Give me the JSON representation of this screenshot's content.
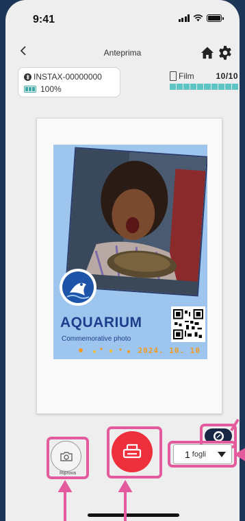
{
  "status": {
    "time": "9:41"
  },
  "nav": {
    "title": "Anteprima"
  },
  "device": {
    "name": "INSTAX-00000000",
    "battery": "100%"
  },
  "film": {
    "label": "Film",
    "count": "10/10",
    "remaining_fraction": 1.0
  },
  "print_preview": {
    "title": "AQUARIUM",
    "subtitle": "Commemorative photo",
    "date": "2024. 10. 10"
  },
  "controls": {
    "retake_label": "Riprova",
    "copies_value": "1",
    "copies_unit": "fogli"
  },
  "colors": {
    "accent_print": "#ee2f3c",
    "highlight": "#e35b9c",
    "film_bar": "#5fc4c4",
    "frame_blue": "#9ec5ee"
  },
  "icons": [
    "home-icon",
    "gear-icon",
    "bluetooth-icon",
    "battery-icon",
    "camera-icon",
    "printer-icon",
    "toggle-icon",
    "chevron-left-icon"
  ]
}
